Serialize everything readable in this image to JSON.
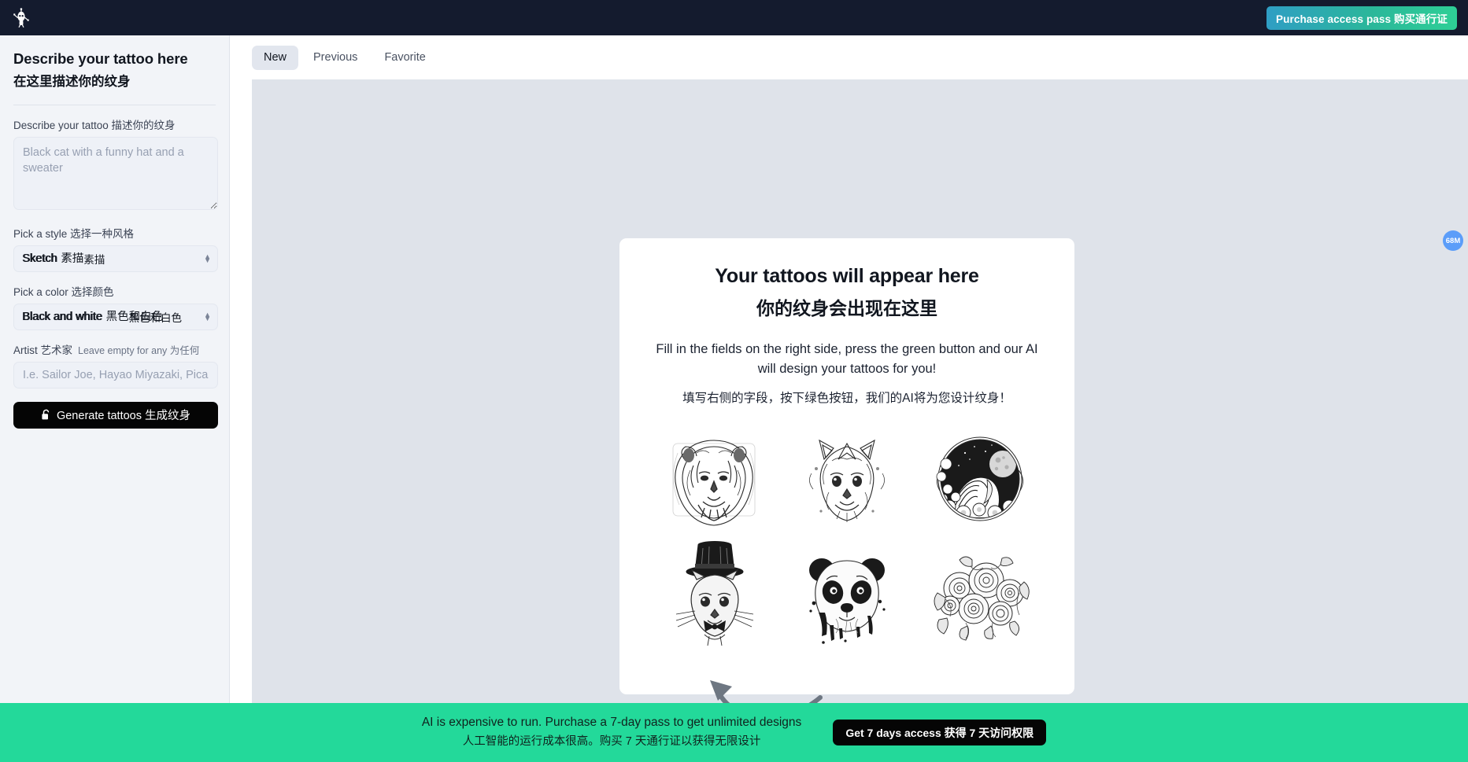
{
  "header": {
    "logo_icon": "robot-mascot-icon",
    "purchase_button": "Purchase access pass 购买通行证",
    "background_color": "#141b2e",
    "purchase_gradient_from": "#2f9ec4",
    "purchase_gradient_to": "#2ecf96"
  },
  "sidebar": {
    "title_en": "Describe your tattoo here",
    "title_zh": "在这里描述你的纹身",
    "describe": {
      "label": "Describe your tattoo 描述你的纹身",
      "placeholder": "Black cat with a funny hat and a sweater",
      "value": ""
    },
    "style": {
      "label": "Pick a style 选择一种风格",
      "selected_en": "Sketch",
      "selected_zh": "素描",
      "options": [
        "Sketch 素描"
      ]
    },
    "color": {
      "label": "Pick a color 选择颜色",
      "selected_en": "Black and white",
      "selected_zh": "黑色和白色",
      "options": [
        "Black and white 黑色和白色"
      ]
    },
    "artist": {
      "label": "Artist 艺术家",
      "hint": "Leave empty for any 为任何",
      "placeholder": "I.e. Sailor Joe, Hayao Miyazaki, Picas",
      "value": ""
    },
    "generate_button": {
      "icon": "open-lock-icon",
      "label": "Generate tattoos 生成纹身"
    }
  },
  "main": {
    "tabs": [
      {
        "label": "New",
        "active": true
      },
      {
        "label": "Previous",
        "active": false
      },
      {
        "label": "Favorite",
        "active": false
      }
    ],
    "placeholder_card": {
      "title_en": "Your tattoos will appear here",
      "title_zh": "你的纹身会出现在这里",
      "body_en": "Fill in the fields on the right side, press the green button and our AI will design your tattoos for you!",
      "body_zh": "填写右侧的字段，按下绿色按钮，我们的AI将为您设计纹身！",
      "samples": [
        {
          "name": "lion-tattoo-sample",
          "icon": "lion-head-mandala"
        },
        {
          "name": "cat-tattoo-sample",
          "icon": "ornate-cat-head"
        },
        {
          "name": "moon-woman-tattoo-sample",
          "icon": "woman-moon-circle"
        },
        {
          "name": "top-hat-cat-tattoo-sample",
          "icon": "cat-with-top-hat"
        },
        {
          "name": "panda-tattoo-sample",
          "icon": "panda-head-ink"
        },
        {
          "name": "roses-tattoo-sample",
          "icon": "rose-bouquet"
        }
      ]
    },
    "arrow_annotation": "curved-arrow-pointing-up-left",
    "canvas_background": "#dfe3ea"
  },
  "side_badge": {
    "label": "68M",
    "color": "#5b9df9"
  },
  "bottom_banner": {
    "text_en": "AI is expensive to run. Purchase a 7-day pass to get unlimited designs",
    "text_zh": "人工智能的运行成本很高。购买 7 天通行证以获得无限设计",
    "button_label": "Get 7 days access 获得 7 天访问权限",
    "background_color": "#23d99a"
  }
}
